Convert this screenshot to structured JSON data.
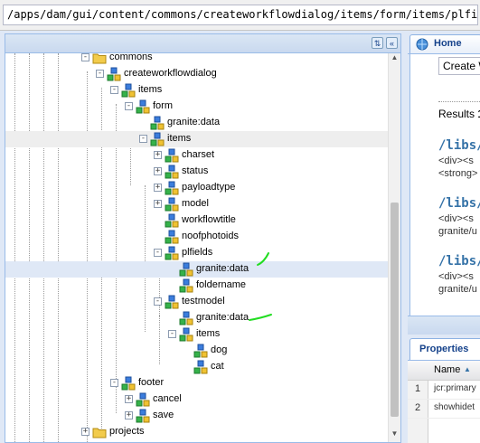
{
  "path_bar": {
    "value": "/apps/dam/gui/content/commons/createworkflowdialog/items/form/items/plfields/granite:data"
  },
  "colors": {
    "annotation_mark": "#22dd22",
    "panel_border": "#99bbe8",
    "link": "#3673a8"
  },
  "tree": {
    "header_buttons": [
      {
        "icon": "refresh-icon"
      },
      {
        "icon": "collapse-icon"
      }
    ],
    "nodes": [
      {
        "label": "commons",
        "icon": "folder-icon",
        "toggle": "-"
      },
      {
        "label": "createworkflowdialog",
        "icon": "node-icon",
        "toggle": "-"
      },
      {
        "label": "items",
        "icon": "node-icon",
        "toggle": "-"
      },
      {
        "label": "form",
        "icon": "node-icon",
        "toggle": "-"
      },
      {
        "label": "granite:data",
        "icon": "node-icon",
        "toggle": ""
      },
      {
        "label": "items",
        "icon": "node-icon",
        "toggle": "-"
      },
      {
        "label": "charset",
        "icon": "node-icon",
        "toggle": "+"
      },
      {
        "label": "status",
        "icon": "node-icon",
        "toggle": "+"
      },
      {
        "label": "payloadtype",
        "icon": "node-icon",
        "toggle": "+"
      },
      {
        "label": "model",
        "icon": "node-icon",
        "toggle": "+"
      },
      {
        "label": "workflowtitle",
        "icon": "node-icon",
        "toggle": ""
      },
      {
        "label": "noofphotoids",
        "icon": "node-icon",
        "toggle": ""
      },
      {
        "label": "plfields",
        "icon": "node-icon",
        "toggle": "-"
      },
      {
        "label": "granite:data",
        "icon": "node-icon",
        "toggle": "",
        "selected": true
      },
      {
        "label": "foldername",
        "icon": "node-icon",
        "toggle": ""
      },
      {
        "label": "testmodel",
        "icon": "node-icon",
        "toggle": "-"
      },
      {
        "label": "granite:data",
        "icon": "node-icon",
        "toggle": ""
      },
      {
        "label": "items",
        "icon": "node-icon",
        "toggle": "-"
      },
      {
        "label": "dog",
        "icon": "node-icon",
        "toggle": ""
      },
      {
        "label": "cat",
        "icon": "node-icon",
        "toggle": ""
      },
      {
        "label": "footer",
        "icon": "node-icon",
        "toggle": "-"
      },
      {
        "label": "cancel",
        "icon": "node-icon",
        "toggle": "+"
      },
      {
        "label": "save",
        "icon": "node-icon",
        "toggle": "+"
      },
      {
        "label": "projects",
        "icon": "folder-icon",
        "toggle": "+"
      }
    ]
  },
  "home": {
    "tab_label": "Home",
    "tab_icon": "home-icon",
    "create_field": "Create W",
    "results_label": "Results",
    "results_value": "1",
    "results": [
      {
        "link": "/libs/co",
        "lines": [
          "<div><s",
          "<strong>"
        ]
      },
      {
        "link": "/libs/co",
        "lines": [
          "<div><s",
          "granite/u"
        ]
      },
      {
        "link": "/libs/w",
        "lines": [
          "<div><s",
          "granite/u"
        ]
      }
    ]
  },
  "properties": {
    "tab_label": "Properties",
    "column_header": "Name",
    "rows": [
      {
        "num": "1",
        "name": "jcr:primary"
      },
      {
        "num": "2",
        "name": "showhidet"
      }
    ]
  }
}
